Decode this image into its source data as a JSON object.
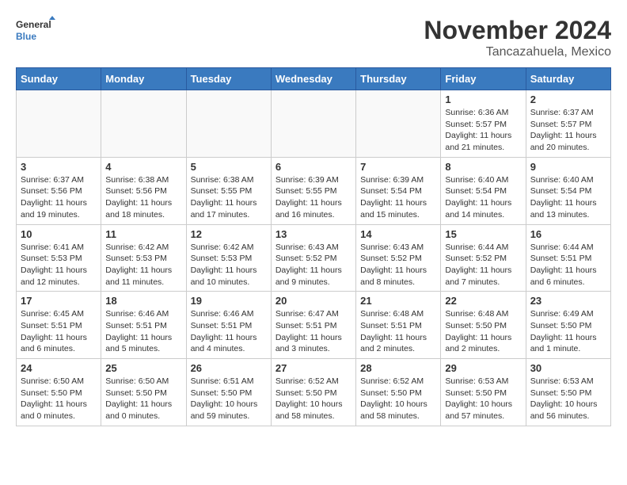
{
  "header": {
    "logo_general": "General",
    "logo_blue": "Blue",
    "month_title": "November 2024",
    "location": "Tancazahuela, Mexico"
  },
  "weekdays": [
    "Sunday",
    "Monday",
    "Tuesday",
    "Wednesday",
    "Thursday",
    "Friday",
    "Saturday"
  ],
  "weeks": [
    [
      {
        "day": "",
        "info": ""
      },
      {
        "day": "",
        "info": ""
      },
      {
        "day": "",
        "info": ""
      },
      {
        "day": "",
        "info": ""
      },
      {
        "day": "",
        "info": ""
      },
      {
        "day": "1",
        "info": "Sunrise: 6:36 AM\nSunset: 5:57 PM\nDaylight: 11 hours and 21 minutes."
      },
      {
        "day": "2",
        "info": "Sunrise: 6:37 AM\nSunset: 5:57 PM\nDaylight: 11 hours and 20 minutes."
      }
    ],
    [
      {
        "day": "3",
        "info": "Sunrise: 6:37 AM\nSunset: 5:56 PM\nDaylight: 11 hours and 19 minutes."
      },
      {
        "day": "4",
        "info": "Sunrise: 6:38 AM\nSunset: 5:56 PM\nDaylight: 11 hours and 18 minutes."
      },
      {
        "day": "5",
        "info": "Sunrise: 6:38 AM\nSunset: 5:55 PM\nDaylight: 11 hours and 17 minutes."
      },
      {
        "day": "6",
        "info": "Sunrise: 6:39 AM\nSunset: 5:55 PM\nDaylight: 11 hours and 16 minutes."
      },
      {
        "day": "7",
        "info": "Sunrise: 6:39 AM\nSunset: 5:54 PM\nDaylight: 11 hours and 15 minutes."
      },
      {
        "day": "8",
        "info": "Sunrise: 6:40 AM\nSunset: 5:54 PM\nDaylight: 11 hours and 14 minutes."
      },
      {
        "day": "9",
        "info": "Sunrise: 6:40 AM\nSunset: 5:54 PM\nDaylight: 11 hours and 13 minutes."
      }
    ],
    [
      {
        "day": "10",
        "info": "Sunrise: 6:41 AM\nSunset: 5:53 PM\nDaylight: 11 hours and 12 minutes."
      },
      {
        "day": "11",
        "info": "Sunrise: 6:42 AM\nSunset: 5:53 PM\nDaylight: 11 hours and 11 minutes."
      },
      {
        "day": "12",
        "info": "Sunrise: 6:42 AM\nSunset: 5:53 PM\nDaylight: 11 hours and 10 minutes."
      },
      {
        "day": "13",
        "info": "Sunrise: 6:43 AM\nSunset: 5:52 PM\nDaylight: 11 hours and 9 minutes."
      },
      {
        "day": "14",
        "info": "Sunrise: 6:43 AM\nSunset: 5:52 PM\nDaylight: 11 hours and 8 minutes."
      },
      {
        "day": "15",
        "info": "Sunrise: 6:44 AM\nSunset: 5:52 PM\nDaylight: 11 hours and 7 minutes."
      },
      {
        "day": "16",
        "info": "Sunrise: 6:44 AM\nSunset: 5:51 PM\nDaylight: 11 hours and 6 minutes."
      }
    ],
    [
      {
        "day": "17",
        "info": "Sunrise: 6:45 AM\nSunset: 5:51 PM\nDaylight: 11 hours and 6 minutes."
      },
      {
        "day": "18",
        "info": "Sunrise: 6:46 AM\nSunset: 5:51 PM\nDaylight: 11 hours and 5 minutes."
      },
      {
        "day": "19",
        "info": "Sunrise: 6:46 AM\nSunset: 5:51 PM\nDaylight: 11 hours and 4 minutes."
      },
      {
        "day": "20",
        "info": "Sunrise: 6:47 AM\nSunset: 5:51 PM\nDaylight: 11 hours and 3 minutes."
      },
      {
        "day": "21",
        "info": "Sunrise: 6:48 AM\nSunset: 5:51 PM\nDaylight: 11 hours and 2 minutes."
      },
      {
        "day": "22",
        "info": "Sunrise: 6:48 AM\nSunset: 5:50 PM\nDaylight: 11 hours and 2 minutes."
      },
      {
        "day": "23",
        "info": "Sunrise: 6:49 AM\nSunset: 5:50 PM\nDaylight: 11 hours and 1 minute."
      }
    ],
    [
      {
        "day": "24",
        "info": "Sunrise: 6:50 AM\nSunset: 5:50 PM\nDaylight: 11 hours and 0 minutes."
      },
      {
        "day": "25",
        "info": "Sunrise: 6:50 AM\nSunset: 5:50 PM\nDaylight: 11 hours and 0 minutes."
      },
      {
        "day": "26",
        "info": "Sunrise: 6:51 AM\nSunset: 5:50 PM\nDaylight: 10 hours and 59 minutes."
      },
      {
        "day": "27",
        "info": "Sunrise: 6:52 AM\nSunset: 5:50 PM\nDaylight: 10 hours and 58 minutes."
      },
      {
        "day": "28",
        "info": "Sunrise: 6:52 AM\nSunset: 5:50 PM\nDaylight: 10 hours and 58 minutes."
      },
      {
        "day": "29",
        "info": "Sunrise: 6:53 AM\nSunset: 5:50 PM\nDaylight: 10 hours and 57 minutes."
      },
      {
        "day": "30",
        "info": "Sunrise: 6:53 AM\nSunset: 5:50 PM\nDaylight: 10 hours and 56 minutes."
      }
    ]
  ]
}
